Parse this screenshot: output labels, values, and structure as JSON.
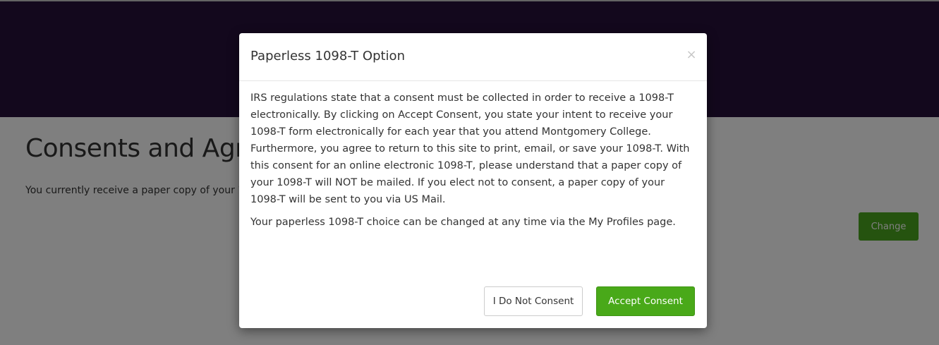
{
  "page": {
    "title": "Consents and Agreements",
    "status": "You currently receive a paper copy of your 1098-T.",
    "change_label": "Change"
  },
  "modal": {
    "title": "Paperless 1098-T Option",
    "close_symbol": "×",
    "paragraph1": "IRS regulations state that a consent must be collected in order to receive a 1098-T electronically. By clicking on Accept Consent, you state your intent to receive your 1098-T form electronically for each year that you attend Montgomery College. Furthermore, you agree to return to this site to print, email, or save your 1098-T. With this consent for an online electronic 1098-T, please understand that a paper copy of your 1098-T will NOT be mailed. If you elect not to consent, a paper copy of your 1098-T will be sent to you via US Mail.",
    "paragraph2": "Your paperless 1098-T choice can be changed at any time via the My Profiles page.",
    "decline_label": "I Do Not Consent",
    "accept_label": "Accept Consent"
  },
  "colors": {
    "header": "#26103b",
    "accent_green": "#49a919",
    "backdrop": "rgba(0,0,0,0.5)"
  },
  "icons": {
    "close": "close-icon"
  }
}
